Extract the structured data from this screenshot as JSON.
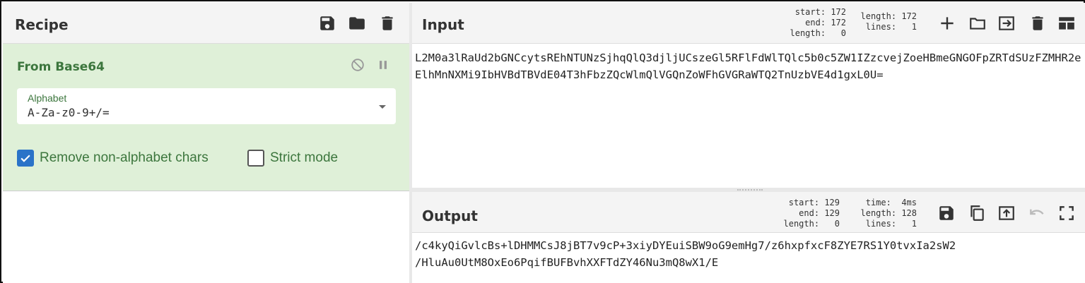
{
  "recipe": {
    "title": "Recipe",
    "icons": [
      "save-icon",
      "folder-icon",
      "trash-icon"
    ],
    "operation": {
      "name": "From Base64",
      "alphabet_label": "Alphabet",
      "alphabet_value": "A-Za-z0-9+/=",
      "remove_non_alphabet_label": "Remove non-alphabet chars",
      "remove_non_alphabet_checked": true,
      "strict_mode_label": "Strict mode",
      "strict_mode_checked": false
    }
  },
  "input": {
    "title": "Input",
    "stats": {
      "start_label": "start:",
      "start": "172",
      "end_label": "end:",
      "end": "172",
      "length_sel_label": "length:",
      "length_sel": "0",
      "length_label": "length:",
      "length": "172",
      "lines_label": "lines:",
      "lines": "1"
    },
    "text": "L2M0a3lRaUd2bGNCcytsREhNTUNzSjhqQlQ3djljUCszeGl5RFlFdWlTQlc5b0c5ZW1IZzcvejZoeHBmeGNGOFpZRTdSUzFZMHR2eElhMnNXMi9IbHVBdTBVdE04T3hFbzZQcWlmQlVGQnZoWFhGVGRaWTQ2TnUzbVE4d1gxL0U="
  },
  "output": {
    "title": "Output",
    "stats": {
      "start_label": "start:",
      "start": "129",
      "end_label": "end:",
      "end": "129",
      "length_sel_label": "length:",
      "length_sel": "0",
      "time_label": "time:",
      "time": "4ms",
      "length_label": "length:",
      "length": "128",
      "lines_label": "lines:",
      "lines": "1"
    },
    "text": "/c4kyQiGvlcBs+lDHMMCsJ8jBT7v9cP+3xiyDYEuiSBW9oG9emHg7/z6hxpfxcF8ZYE7RS1Y0tvxIa2sW2\n/HluAu0UtM8OxEo6PqifBUFBvhXXFTdZY46Nu3mQ8wX1/E"
  },
  "colors": {
    "accent_green": "#3c763d",
    "op_background": "#dff0d8",
    "checkbox_blue": "#2a73c8"
  }
}
